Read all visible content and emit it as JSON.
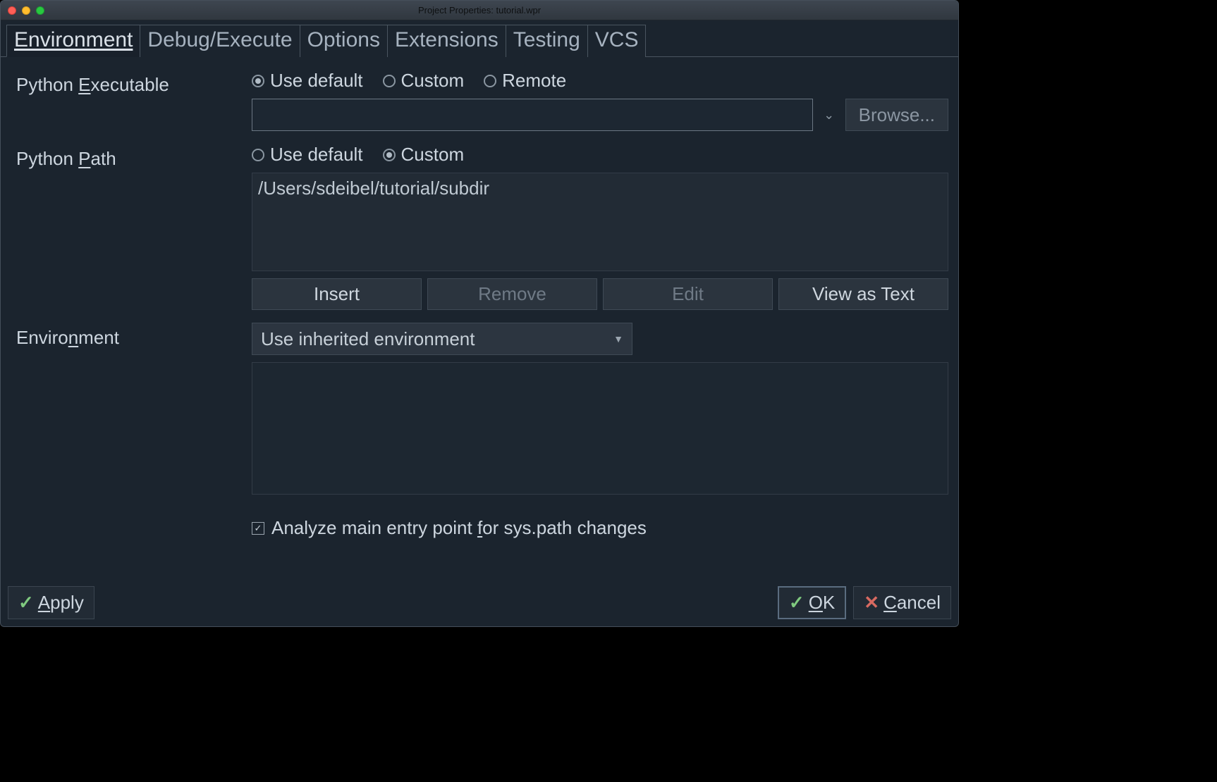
{
  "window": {
    "title": "Project Properties: tutorial.wpr"
  },
  "tabs": [
    {
      "label": "Environment",
      "active": true
    },
    {
      "label": "Debug/Execute",
      "active": false
    },
    {
      "label": "Options",
      "active": false
    },
    {
      "label": "Extensions",
      "active": false
    },
    {
      "label": "Testing",
      "active": false
    },
    {
      "label": "VCS",
      "active": false
    }
  ],
  "python_executable": {
    "label_prefix": "Python ",
    "label_underline": "E",
    "label_suffix": "xecutable",
    "radios": {
      "use_default": "Use default",
      "custom": "Custom",
      "remote": "Remote",
      "selected": "use_default"
    },
    "value": "",
    "browse_label": "Browse..."
  },
  "python_path": {
    "label_prefix": "Python ",
    "label_underline": "P",
    "label_suffix": "ath",
    "radios": {
      "use_default": "Use default",
      "custom": "Custom",
      "selected": "custom"
    },
    "entries": [
      "/Users/sdeibel/tutorial/subdir"
    ],
    "buttons": {
      "insert": "Insert",
      "remove": "Remove",
      "edit": "Edit",
      "view_as_text": "View as Text"
    }
  },
  "environment": {
    "label_prefix": "Enviro",
    "label_underline": "n",
    "label_suffix": "ment",
    "select_value": "Use inherited environment",
    "entries": []
  },
  "analyze_checkbox": {
    "label_prefix": "Analyze main entry point ",
    "label_underline": "f",
    "label_suffix": "or sys.path changes",
    "checked": true
  },
  "footer": {
    "apply_underline": "A",
    "apply_suffix": "pply",
    "ok_underline": "O",
    "ok_suffix": "K",
    "cancel_underline": "C",
    "cancel_suffix": "ancel"
  }
}
